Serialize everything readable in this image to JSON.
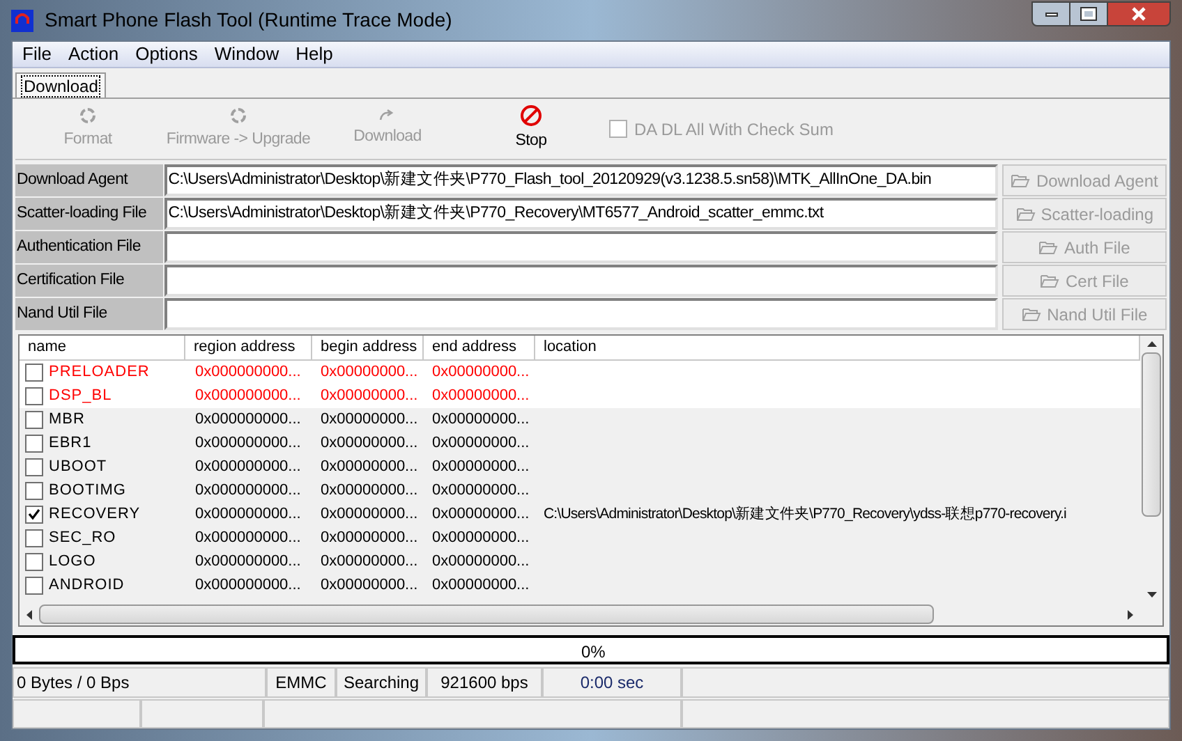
{
  "window": {
    "title": "Smart Phone Flash Tool (Runtime Trace Mode)"
  },
  "menu": [
    "File",
    "Action",
    "Options",
    "Window",
    "Help"
  ],
  "tabs": [
    {
      "label": "Download",
      "selected": true
    }
  ],
  "toolbar": [
    {
      "kind": "format",
      "label": "Format",
      "disabled": true
    },
    {
      "kind": "firmware",
      "label": "Firmware -> Upgrade",
      "disabled": true
    },
    {
      "kind": "download",
      "label": "Download",
      "disabled": true
    },
    {
      "kind": "stop",
      "label": "Stop",
      "disabled": false
    }
  ],
  "checksum": {
    "label": "DA DL All With Check Sum",
    "checked": false,
    "disabled": true
  },
  "files": [
    {
      "label": "Download Agent",
      "value": "C:\\Users\\Administrator\\Desktop\\新建文件夹\\P770_Flash_tool_20120929(v3.1238.5.sn58)\\MTK_AllInOne_DA.bin",
      "button": "Download Agent",
      "disabled": true
    },
    {
      "label": "Scatter-loading File",
      "value": "C:\\Users\\Administrator\\Desktop\\新建文件夹\\P770_Recovery\\MT6577_Android_scatter_emmc.txt",
      "button": "Scatter-loading",
      "disabled": true
    },
    {
      "label": "Authentication File",
      "button": "Auth File",
      "disabled": true
    },
    {
      "label": "Certification File",
      "button": "Cert File",
      "disabled": true
    },
    {
      "label": "Nand Util File",
      "button": "Nand Util File",
      "disabled": true
    }
  ],
  "table": {
    "columns": [
      "name",
      "region address",
      "begin address",
      "end address",
      "location"
    ],
    "rows": [
      {
        "name": "PRELOADER",
        "region": "0x000000000...",
        "begin": "0x00000000...",
        "end": "0x00000000...",
        "error": true,
        "checked": false
      },
      {
        "name": "DSP_BL",
        "region": "0x000000000...",
        "begin": "0x00000000...",
        "end": "0x00000000...",
        "error": true,
        "checked": false
      },
      {
        "name": "MBR",
        "region": "0x000000000...",
        "begin": "0x00000000...",
        "end": "0x00000000...",
        "error": false,
        "checked": false
      },
      {
        "name": "EBR1",
        "region": "0x000000000...",
        "begin": "0x00000000...",
        "end": "0x00000000...",
        "error": false,
        "checked": false
      },
      {
        "name": "UBOOT",
        "region": "0x000000000...",
        "begin": "0x00000000...",
        "end": "0x00000000...",
        "error": false,
        "checked": false
      },
      {
        "name": "BOOTIMG",
        "region": "0x000000000...",
        "begin": "0x00000000...",
        "end": "0x00000000...",
        "error": false,
        "checked": false
      },
      {
        "name": "RECOVERY",
        "region": "0x000000000...",
        "begin": "0x00000000...",
        "end": "0x00000000...",
        "location": "C:\\Users\\Administrator\\Desktop\\新建文件夹\\P770_Recovery\\ydss-联想p770-recovery.i",
        "error": false,
        "checked": true
      },
      {
        "name": "SEC_RO",
        "region": "0x000000000...",
        "begin": "0x00000000...",
        "end": "0x00000000...",
        "error": false,
        "checked": false
      },
      {
        "name": "LOGO",
        "region": "0x000000000...",
        "begin": "0x00000000...",
        "end": "0x00000000...",
        "error": false,
        "checked": false
      },
      {
        "name": "ANDROID",
        "region": "0x000000000...",
        "begin": "0x00000000...",
        "end": "0x00000000...",
        "error": false,
        "checked": false
      }
    ]
  },
  "progress": {
    "label": "0%",
    "level": 0
  },
  "status_bar": [
    "0 Bytes / 0 Bps",
    "EMMC",
    "Searching",
    "921600 bps",
    "0:00 sec"
  ]
}
